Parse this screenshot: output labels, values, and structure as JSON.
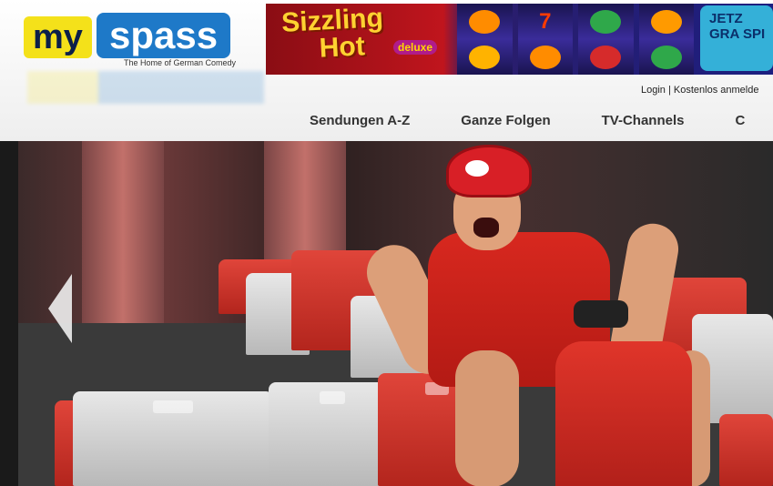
{
  "site": {
    "logo_my": "my",
    "logo_spass": "spass",
    "tagline": "The Home of German Comedy"
  },
  "banner": {
    "title_line1": "Sizzling",
    "title_line2": "Hot",
    "subtitle": "deluxe",
    "cta": "JETZ GRA SPI"
  },
  "account": {
    "login": "Login",
    "separator": "|",
    "register": "Kostenlos anmelde"
  },
  "nav": [
    {
      "label": "Sendungen A-Z"
    },
    {
      "label": "Ganze Folgen"
    },
    {
      "label": "TV-Channels"
    },
    {
      "label": "C"
    }
  ],
  "hero": {
    "prev_arrow": "chevron-left-icon"
  },
  "colors": {
    "logo_yellow": "#f4e11a",
    "logo_blue": "#1e79c8",
    "accent_red": "#d81f26"
  }
}
